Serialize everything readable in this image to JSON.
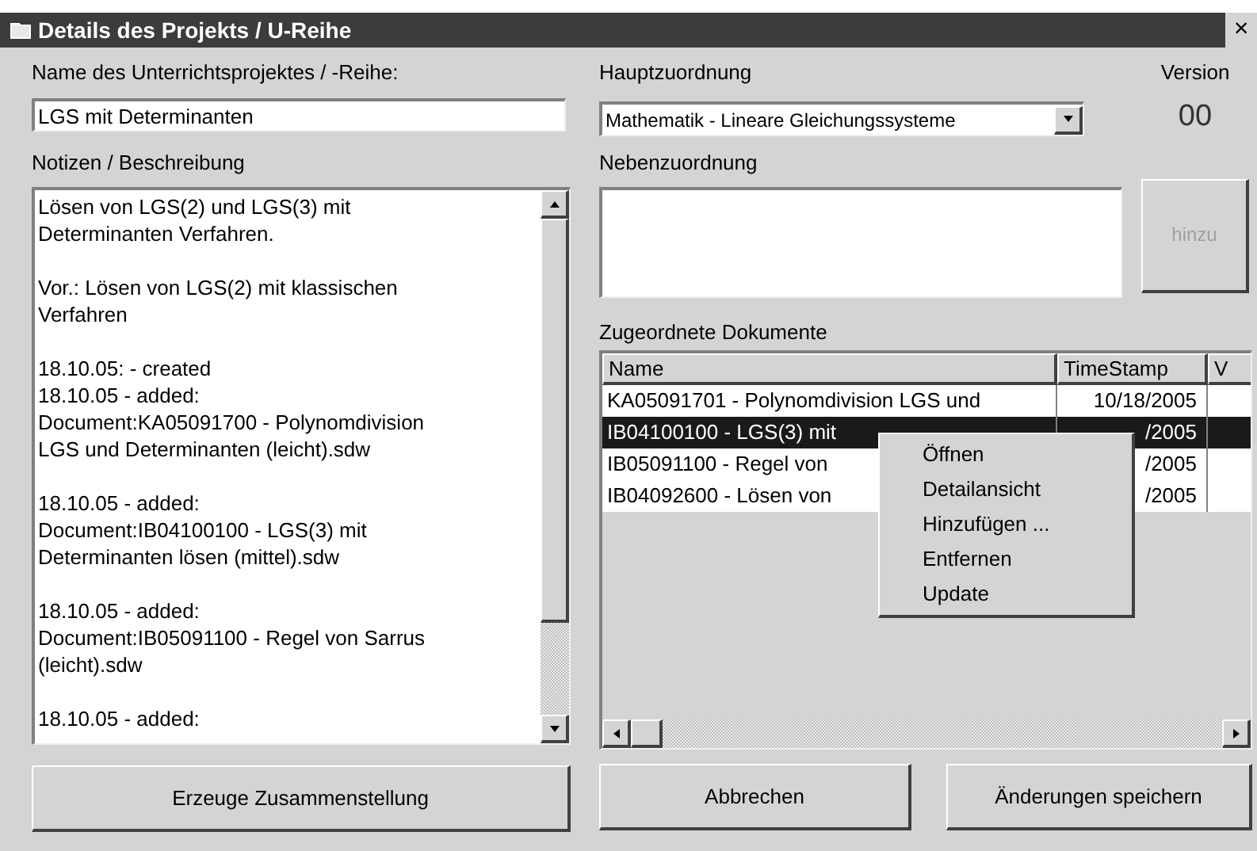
{
  "window": {
    "title": "Details des Projekts / U-Reihe",
    "close": "×"
  },
  "name_field": {
    "label": "Name des Unterrichtsprojektes / -Reihe:",
    "value": "LGS mit Determinanten"
  },
  "notes": {
    "label": "Notizen / Beschreibung",
    "paragraphs": [
      [
        "Lösen von LGS(2) und LGS(3) mit",
        "Determinanten Verfahren."
      ],
      [
        "Vor.: Lösen von LGS(2) mit klassischen",
        "Verfahren"
      ],
      [
        "18.10.05: - created",
        "18.10.05 - added:",
        "Document:KA05091700 - Polynomdivision",
        "LGS und Determinanten (leicht).sdw"
      ],
      [
        "18.10.05 - added:",
        "Document:IB04100100 - LGS(3) mit",
        "Determinanten lösen (mittel).sdw"
      ],
      [
        "18.10.05 - added:",
        "Document:IB05091100 - Regel von Sarrus",
        "(leicht).sdw"
      ],
      [
        "18.10.05 - added:"
      ]
    ]
  },
  "main_assignment": {
    "label": "Hauptzuordnung",
    "value": "Mathematik - Lineare Gleichungssysteme"
  },
  "version": {
    "label": "Version",
    "value": "00"
  },
  "secondary_assignment": {
    "label": "Nebenzuordnung",
    "add_button": {
      "label": "hinzu",
      "disabled": true
    }
  },
  "documents": {
    "label": "Zugeordnete Dokumente",
    "columns": [
      "Name",
      "TimeStamp",
      "V"
    ],
    "rows": [
      {
        "name": "KA05091701 - Polynomdivision LGS und",
        "timestamp": "10/18/2005",
        "selected": false
      },
      {
        "name": "IB04100100 - LGS(3) mit",
        "timestamp": "/2005",
        "selected": true
      },
      {
        "name": "IB05091100 - Regel von",
        "timestamp": "/2005",
        "selected": false
      },
      {
        "name": "IB04092600 - Lösen von",
        "timestamp": "/2005",
        "selected": false
      }
    ]
  },
  "context_menu": [
    "Öffnen",
    "Detailansicht",
    "Hinzufügen ...",
    "Entfernen",
    "Update"
  ],
  "buttons": {
    "generate": "Erzeuge Zusammenstellung",
    "cancel": "Abbrechen",
    "save": "Änderungen speichern"
  }
}
